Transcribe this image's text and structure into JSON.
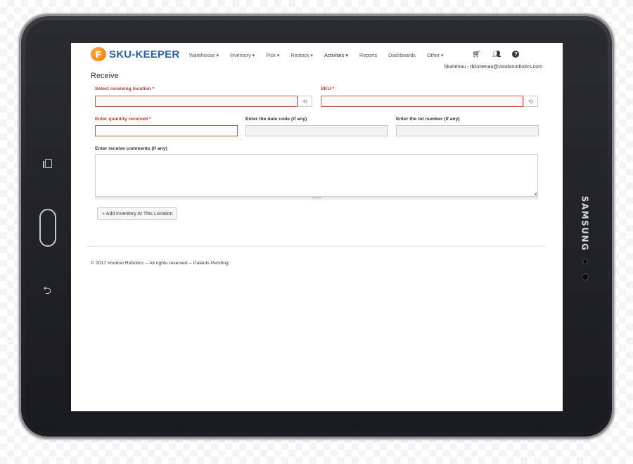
{
  "device": {
    "brand": "SAMSUNG"
  },
  "app": {
    "logo_letter": "F",
    "logo_text": "SKU-KEEPER",
    "menu": [
      {
        "label": "Warehouse ▾"
      },
      {
        "label": "Inventory ▾"
      },
      {
        "label": "Pick ▾"
      },
      {
        "label": "Restock ▾"
      },
      {
        "label": "Activities ▾"
      },
      {
        "label": "Reports"
      },
      {
        "label": "Dashboards"
      },
      {
        "label": "Other ▾"
      }
    ],
    "icons": {
      "cart": "cart-icon",
      "users": "users-icon",
      "help": "help-icon"
    },
    "user_line": "blumenau - tblumenau@voodoorobotics.com",
    "accent_color": "#2f5f9c",
    "logo_color": "#f58a1f",
    "error_color": "#b53a2e"
  },
  "page": {
    "title": "Receive"
  },
  "form": {
    "location_label": "Select receiving location *",
    "sku_label": "SKU *",
    "quantity_label": "Enter quantity received *",
    "date_code_label": "Enter the date code (if any)",
    "lot_label": "Enter the lot number (if any)",
    "comments_label": "Enter receive comments (if any)",
    "location_value": "",
    "sku_value": "",
    "quantity_value": "",
    "date_code_value": "",
    "lot_value": "",
    "comments_value": "",
    "add_button": "+ Add Inventory At This Location"
  },
  "footer": {
    "text": "© 2017 Voodoo Robotics -- All rights reserved -- Patents Pending"
  }
}
